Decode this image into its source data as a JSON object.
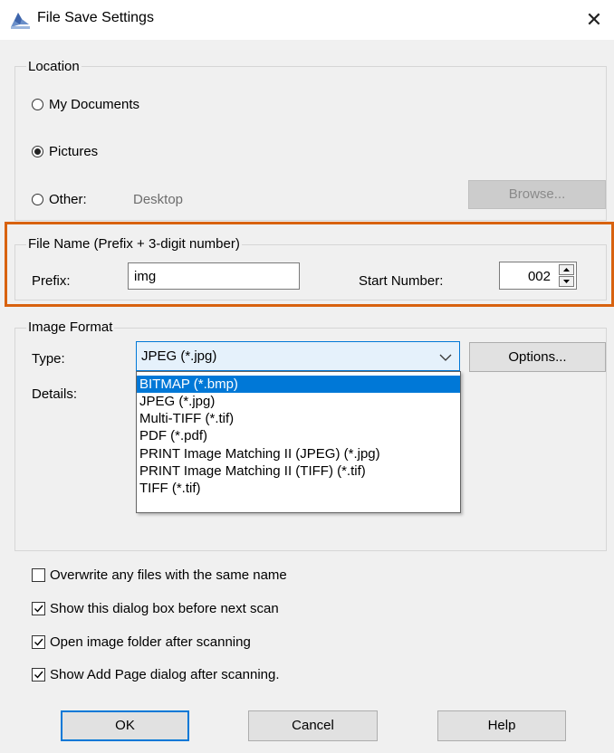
{
  "window": {
    "title": "File Save Settings",
    "close_glyph": "✕"
  },
  "location": {
    "legend": "Location",
    "options": [
      {
        "label": "My Documents",
        "checked": false
      },
      {
        "label": "Pictures",
        "checked": true
      },
      {
        "label": "Other:",
        "checked": false
      }
    ],
    "other_path": "Desktop",
    "browse_label": "Browse..."
  },
  "filename": {
    "legend": "File Name (Prefix + 3-digit number)",
    "prefix_label": "Prefix:",
    "prefix_value": "img",
    "start_label": "Start Number:",
    "start_value": "002"
  },
  "image_format": {
    "legend": "Image Format",
    "type_label": "Type:",
    "type_value": "JPEG (*.jpg)",
    "options_label": "Options...",
    "details_label": "Details:",
    "dropdown_options": [
      "BITMAP (*.bmp)",
      "JPEG (*.jpg)",
      "Multi-TIFF (*.tif)",
      "PDF (*.pdf)",
      "PRINT Image Matching II (JPEG) (*.jpg)",
      "PRINT Image Matching II (TIFF) (*.tif)",
      "TIFF (*.tif)"
    ],
    "highlighted_option": "BITMAP (*.bmp)"
  },
  "checkboxes": [
    {
      "label": "Overwrite any files with the same name",
      "checked": false
    },
    {
      "label": "Show this dialog box before next scan",
      "checked": true
    },
    {
      "label": "Open image folder after scanning",
      "checked": true
    },
    {
      "label": "Show Add Page dialog after scanning.",
      "checked": true
    }
  ],
  "buttons": {
    "ok": "OK",
    "cancel": "Cancel",
    "help": "Help"
  },
  "colors": {
    "accent": "#0078d7",
    "highlight_border": "#d8620f"
  }
}
